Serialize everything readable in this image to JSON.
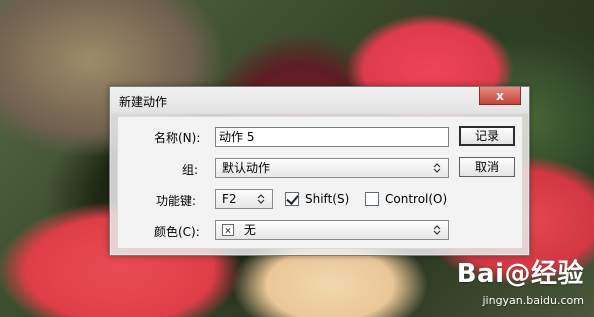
{
  "dialog": {
    "title": "新建动作",
    "close_glyph": "x",
    "fields": {
      "name": {
        "label": "名称(N):",
        "value": "动作 5"
      },
      "group": {
        "label": "组:",
        "selected": "默认动作"
      },
      "hotkey": {
        "label": "功能键:",
        "selected": "F2"
      },
      "shift": {
        "label": "Shift(S)",
        "checked": true
      },
      "control": {
        "label": "Control(O)",
        "checked": false
      },
      "color": {
        "label": "颜色(C):",
        "selected": "无"
      }
    },
    "buttons": {
      "record": "记录",
      "cancel": "取消"
    }
  },
  "watermark": {
    "brand": "Bai@经验",
    "url": "jingyan.baidu.com"
  }
}
